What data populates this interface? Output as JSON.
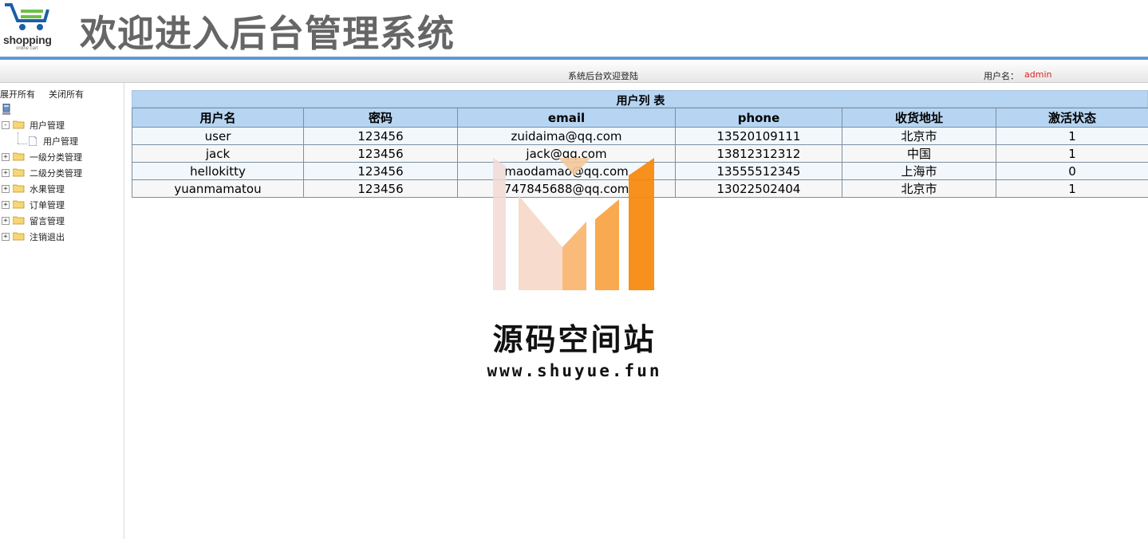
{
  "header": {
    "logo_text": "shopping",
    "logo_subtext": "online cart",
    "title": "欢迎进入后台管理系统",
    "welcome": "系统后台欢迎登陆",
    "user_label": "用户名：",
    "user_name": "admin"
  },
  "sidebar": {
    "expand_all": "展开所有",
    "collapse_all": "关闭所有",
    "items": [
      {
        "label": "用户管理",
        "expanded": true,
        "toggle": "-"
      },
      {
        "label": "用户管理",
        "child": true
      },
      {
        "label": "一级分类管理",
        "toggle": "+"
      },
      {
        "label": "二级分类管理",
        "toggle": "+"
      },
      {
        "label": "水果管理",
        "toggle": "+"
      },
      {
        "label": "订单管理",
        "toggle": "+"
      },
      {
        "label": "留言管理",
        "toggle": "+"
      },
      {
        "label": "注销退出",
        "toggle": "+"
      }
    ]
  },
  "table": {
    "title": "用户列 表",
    "columns": [
      "用户名",
      "密码",
      "email",
      "phone",
      "收货地址",
      "激活状态"
    ],
    "rows": [
      [
        "user",
        "123456",
        "zuidaima@qq.com",
        "13520109111",
        "北京市",
        "1"
      ],
      [
        "jack",
        "123456",
        "jack@qq.com",
        "13812312312",
        "中国",
        "1"
      ],
      [
        "hellokitty",
        "123456",
        "maodamao@qq.com",
        "13555512345",
        "上海市",
        "0"
      ],
      [
        "yuanmamatou",
        "123456",
        "747845688@qq.com",
        "13022502404",
        "北京市",
        "1"
      ]
    ]
  },
  "watermark": {
    "name": "源码空间站",
    "url": "www.shuyue.fun"
  },
  "colors": {
    "accent": "#5b9bd5",
    "table_header": "#b6d5f2",
    "username": "#e02020"
  }
}
